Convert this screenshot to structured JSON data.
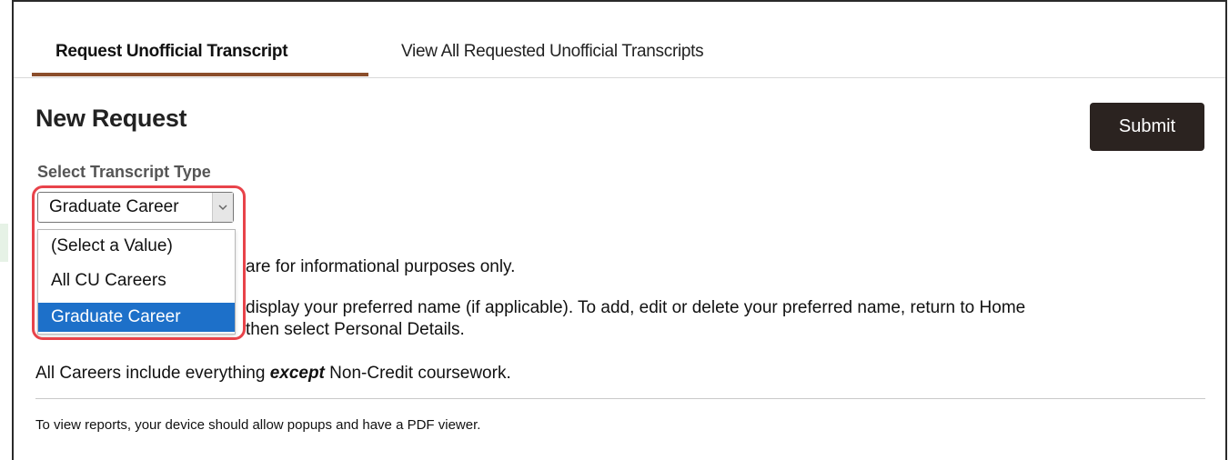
{
  "tabs": {
    "active_label": "Request Unofficial Transcript",
    "other_label": "View All Requested Unofficial Transcripts"
  },
  "page": {
    "title": "New Request",
    "submit_label": "Submit"
  },
  "transcript_type": {
    "label": "Select Transcript Type",
    "selected_value": "Graduate Career",
    "options": [
      "(Select a Value)",
      "All CU Careers",
      "Graduate Career"
    ],
    "selected_index": 2
  },
  "info": {
    "line1_visible": "are for informational purposes only.",
    "line2_visible": "display your preferred name (if applicable). To add, edit or delete your preferred name, return to Home",
    "line3_visible": "then select Personal Details.",
    "careers_prefix": "All Careers include everything ",
    "careers_emphasis": "except",
    "careers_suffix": " Non-Credit coursework.",
    "popup_note": "To view reports, your device should allow popups and have a PDF viewer."
  },
  "colors": {
    "tab_underline": "#8b4e2b",
    "submit_bg": "#2b2320",
    "selected_option_bg": "#1d70c9",
    "highlight_border": "#e8434a"
  }
}
